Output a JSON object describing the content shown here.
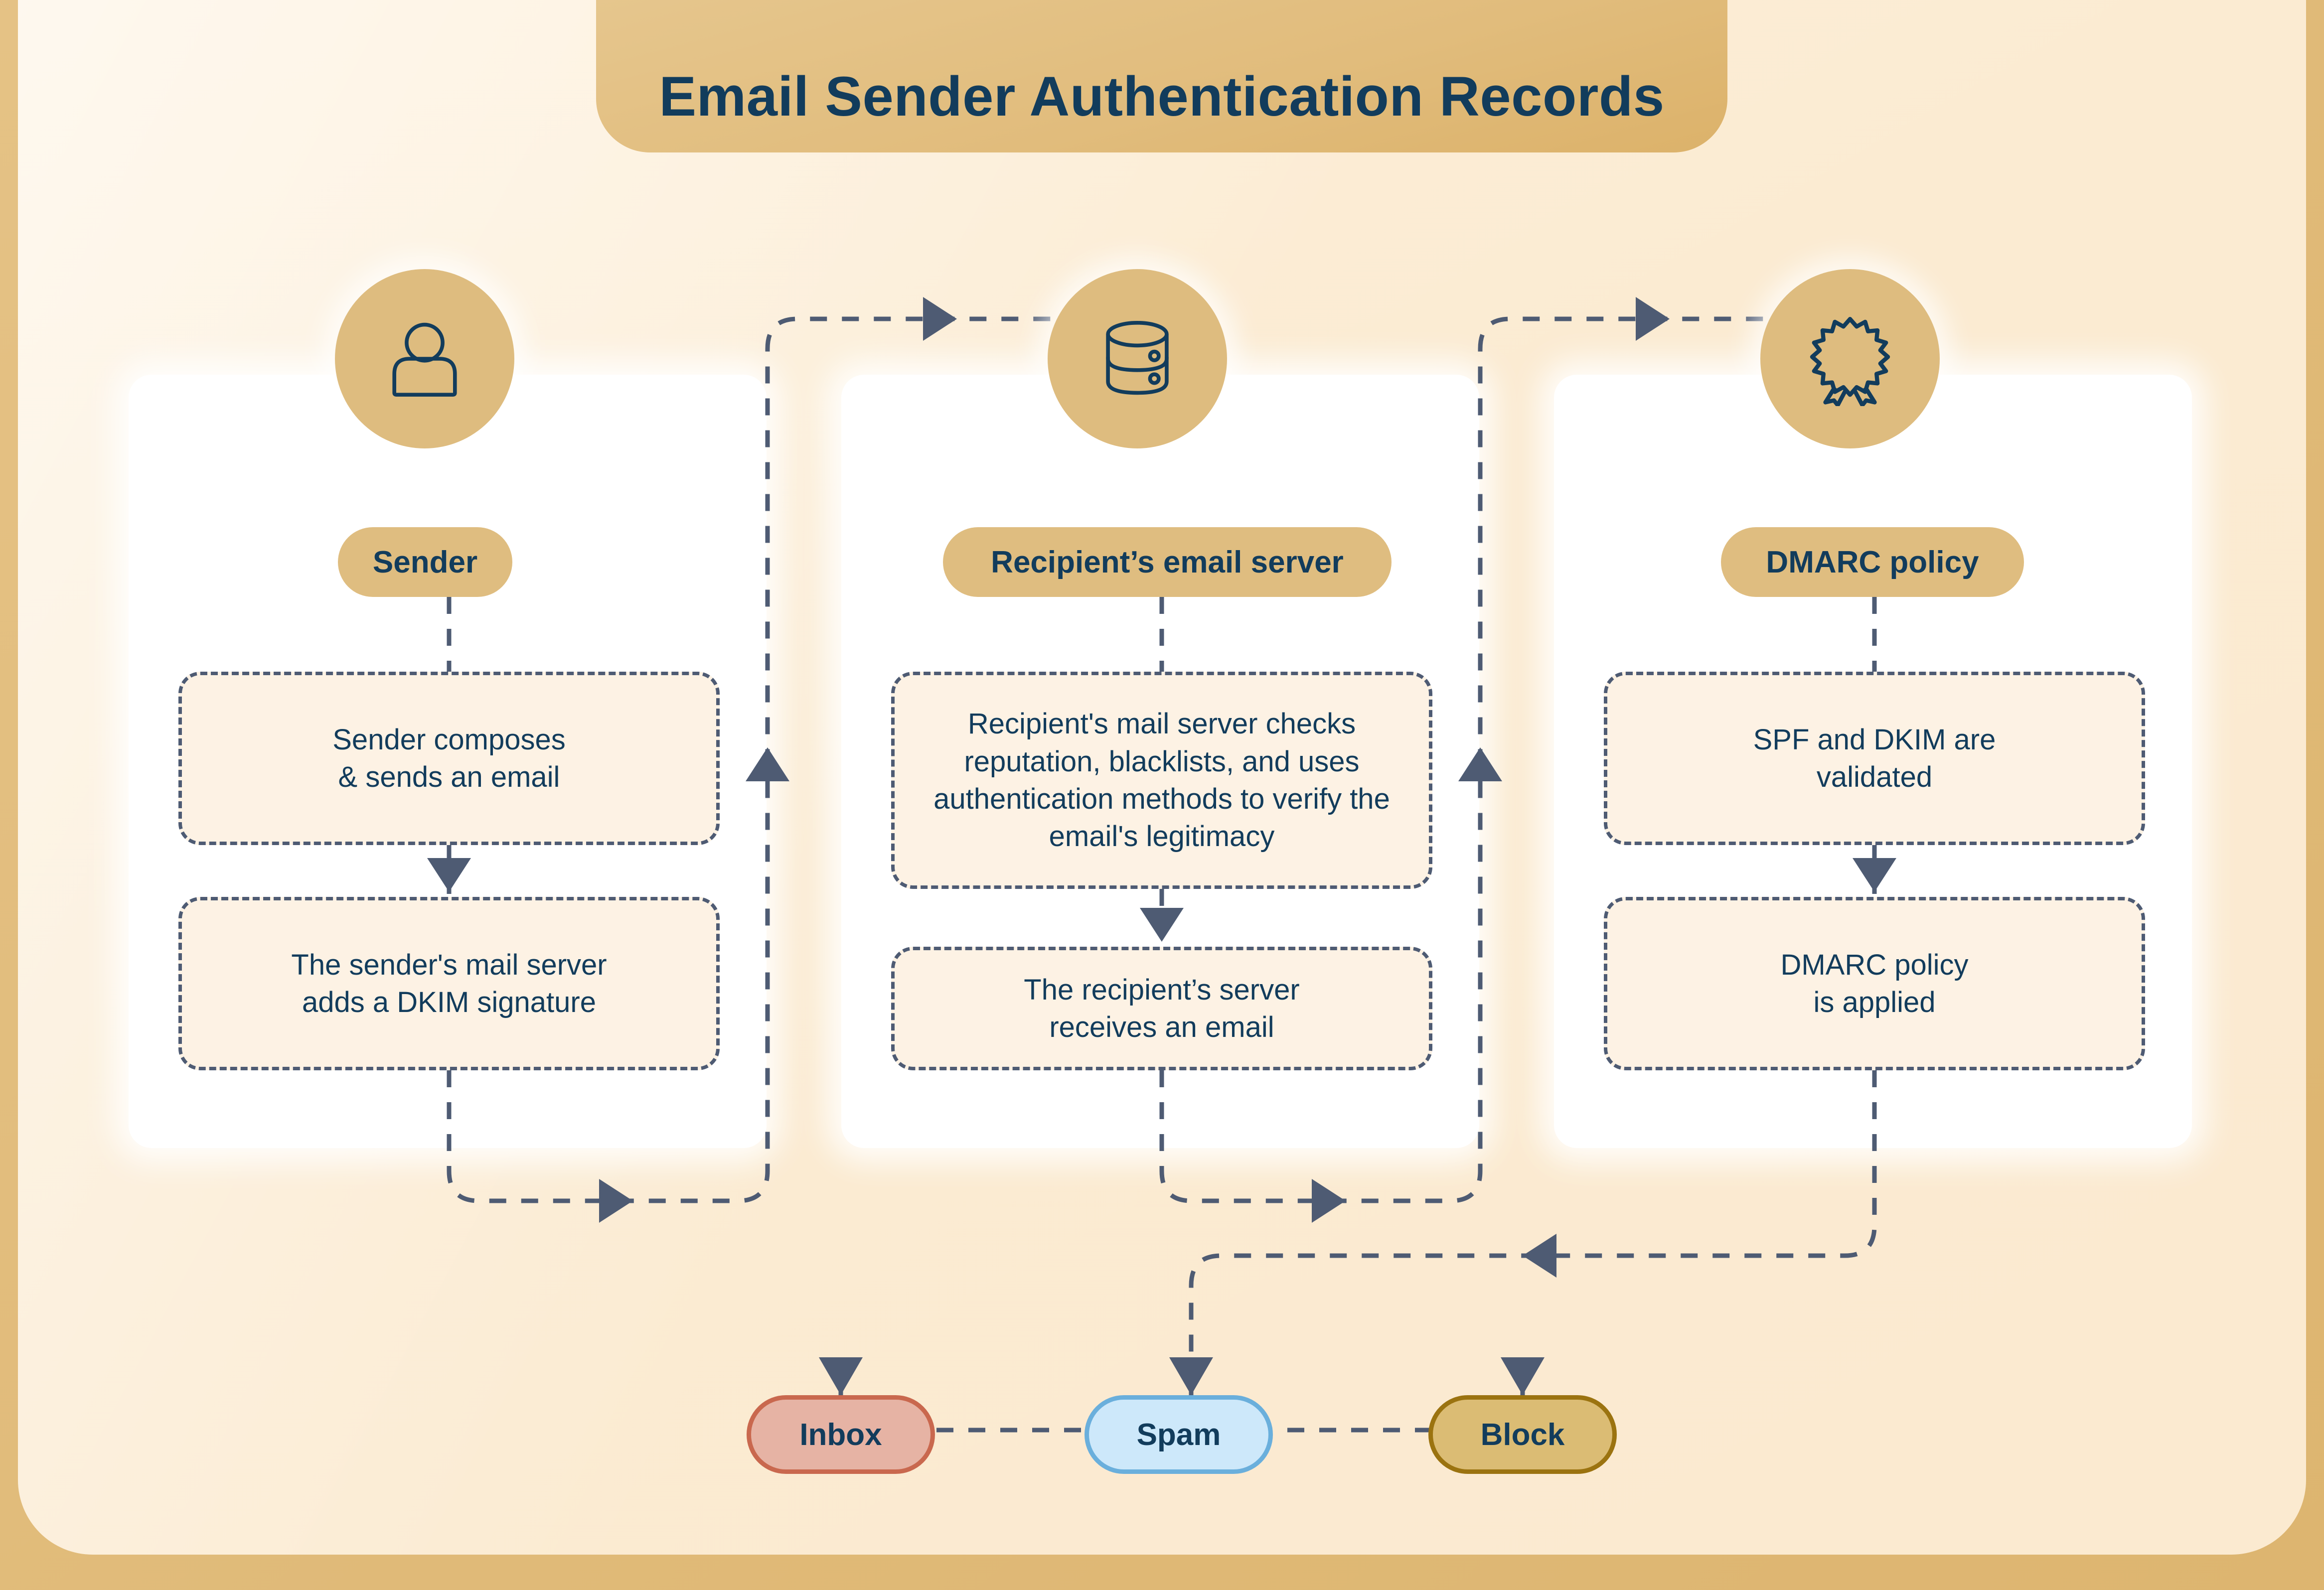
{
  "page": {
    "title": "Email Sender Authentication Records",
    "colors": {
      "frame_gold": "#E0BA78",
      "panel_cream": "#FBEBD2",
      "card_white": "#FFFFFF",
      "pill_gold": "#DEBC7F",
      "text_navy": "#123C5C",
      "dash_slate": "#4E5B73",
      "step_fill": "#FDF2E4",
      "inbox_fill": "#E6B3A4",
      "inbox_border": "#C9684E",
      "spam_fill": "#CDE8FA",
      "spam_border": "#6AAFDC",
      "block_fill": "#DBBC74",
      "block_border": "#9B7310"
    }
  },
  "columns": [
    {
      "id": "sender",
      "icon": "person-icon",
      "label": "Sender",
      "steps": [
        "Sender composes\n& sends an email",
        "The sender's mail server\nadds a DKIM signature"
      ]
    },
    {
      "id": "recipient",
      "icon": "database-icon",
      "label": "Recipient’s email server",
      "steps": [
        "Recipient's mail server checks reputation, blacklists, and uses authentication methods to verify the email's legitimacy",
        "The recipient’s server\nreceives an email"
      ]
    },
    {
      "id": "dmarc",
      "icon": "award-ribbon-icon",
      "label": "DMARC policy",
      "steps": [
        "SPF and DKIM are\nvalidated",
        "DMARC policy\nis applied"
      ]
    }
  ],
  "outcomes": [
    {
      "id": "inbox",
      "label": "Inbox"
    },
    {
      "id": "spam",
      "label": "Spam"
    },
    {
      "id": "block",
      "label": "Block"
    }
  ],
  "flow": {
    "description": "Sender column flows down, routes right and up into Recipient column; Recipient column flows down, routes right and up into DMARC column; DMARC column flows down, routes left and down, then splits into Inbox, Spam and Block outcomes.",
    "arrow_style": "dashed-with-filled-triangle-heads"
  }
}
